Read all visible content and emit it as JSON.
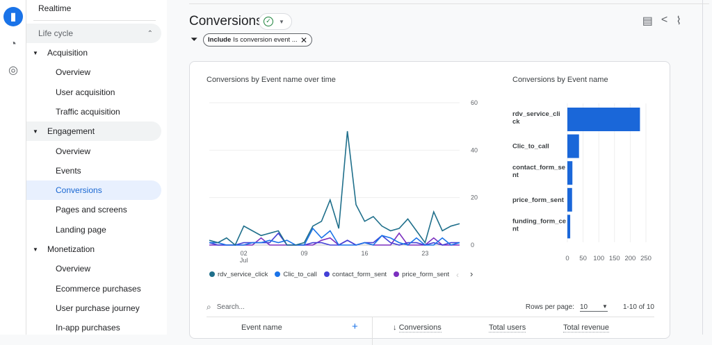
{
  "rail": {
    "icons": [
      "reports-icon",
      "explore-icon",
      "advertising-icon"
    ]
  },
  "sidebar": {
    "realtime": "Realtime",
    "lifecycle": "Life cycle",
    "acquisition": "Acquisition",
    "acq_items": [
      "Overview",
      "User acquisition",
      "Traffic acquisition"
    ],
    "engagement": "Engagement",
    "eng_items": [
      "Overview",
      "Events",
      "Conversions",
      "Pages and screens",
      "Landing page"
    ],
    "monetization": "Monetization",
    "mon_items": [
      "Overview",
      "Ecommerce purchases",
      "User purchase journey",
      "In-app purchases"
    ]
  },
  "header": {
    "title": "Conversions",
    "filter_bold": "Include",
    "filter_text": "Is conversion event ..."
  },
  "colors": {
    "accent": "#1a73e8",
    "rdv": "#1f6f8b",
    "clic": "#1a73e8",
    "contact": "#4340d6",
    "price": "#7b2fbf",
    "bar": "#1a67d9"
  },
  "chart_data": [
    {
      "type": "line",
      "title": "Conversions by Event name over time",
      "x": [
        "Jun 28",
        "Jun 29",
        "Jun 30",
        "Jul 1",
        "Jul 2",
        "Jul 3",
        "Jul 4",
        "Jul 5",
        "Jul 6",
        "Jul 7",
        "Jul 8",
        "Jul 9",
        "Jul 10",
        "Jul 11",
        "Jul 12",
        "Jul 13",
        "Jul 14",
        "Jul 15",
        "Jul 16",
        "Jul 17",
        "Jul 18",
        "Jul 19",
        "Jul 20",
        "Jul 21",
        "Jul 22",
        "Jul 23",
        "Jul 24",
        "Jul 25",
        "Jul 26",
        "Jul 27"
      ],
      "xticks": [
        {
          "label": "02",
          "sub": "Jul",
          "index": 4
        },
        {
          "label": "09",
          "sub": "",
          "index": 11
        },
        {
          "label": "16",
          "sub": "",
          "index": 18
        },
        {
          "label": "23",
          "sub": "",
          "index": 25
        }
      ],
      "yticks": [
        "0",
        "20",
        "40",
        "60"
      ],
      "ylim": [
        0,
        60
      ],
      "grid": true,
      "legend": "bottom",
      "series": [
        {
          "name": "rdv_service_click",
          "color": "#1f6f8b",
          "values": [
            2,
            1,
            3,
            0,
            8,
            6,
            4,
            5,
            6,
            0,
            0,
            1,
            8,
            10,
            19,
            7,
            48,
            17,
            10,
            12,
            8,
            6,
            7,
            11,
            6,
            1,
            14,
            6,
            8,
            9
          ]
        },
        {
          "name": "Clic_to_call",
          "color": "#1a73e8",
          "values": [
            1,
            1,
            0,
            0,
            0,
            1,
            1,
            2,
            1,
            2,
            0,
            0,
            7,
            3,
            6,
            0,
            0,
            0,
            1,
            0,
            4,
            3,
            1,
            0,
            3,
            0,
            0,
            3,
            0,
            1
          ]
        },
        {
          "name": "contact_form_sent",
          "color": "#4340d6",
          "values": [
            1,
            0,
            0,
            0,
            1,
            1,
            1,
            1,
            5,
            0,
            0,
            0,
            1,
            1,
            0,
            0,
            2,
            0,
            1,
            1,
            4,
            1,
            0,
            1,
            1,
            0,
            1,
            0,
            1,
            1
          ]
        },
        {
          "name": "price_form_sent",
          "color": "#7b2fbf",
          "values": [
            0,
            0,
            0,
            0,
            0,
            0,
            3,
            0,
            0,
            0,
            0,
            0,
            0,
            2,
            3,
            0,
            2,
            0,
            1,
            0,
            0,
            0,
            5,
            0,
            0,
            0,
            3,
            0,
            0,
            0
          ]
        }
      ]
    },
    {
      "type": "bar",
      "title": "Conversions by Event name",
      "categories": [
        "rdv_service_click",
        "Clic_to_call",
        "contact_form_sent",
        "price_form_sent",
        "funding_form_cent"
      ],
      "category_lines": [
        [
          "rdv_service_cli",
          "ck"
        ],
        [
          "Clic_to_call"
        ],
        [
          "contact_form_se",
          "nt"
        ],
        [
          "price_form_sent"
        ],
        [
          "funding_form_ce",
          "nt"
        ]
      ],
      "values": [
        231,
        37,
        16,
        15,
        9
      ],
      "xticks": [
        "0",
        "50",
        "100",
        "150",
        "200",
        "250"
      ],
      "xlim": [
        0,
        250
      ],
      "grid": true
    }
  ],
  "table": {
    "search_placeholder": "Search...",
    "rows_per_page_label": "Rows per page:",
    "rows_per_page": "10",
    "range": "1-10 of 10",
    "headers": [
      "Event name",
      "Conversions",
      "Total users",
      "Total revenue"
    ]
  }
}
